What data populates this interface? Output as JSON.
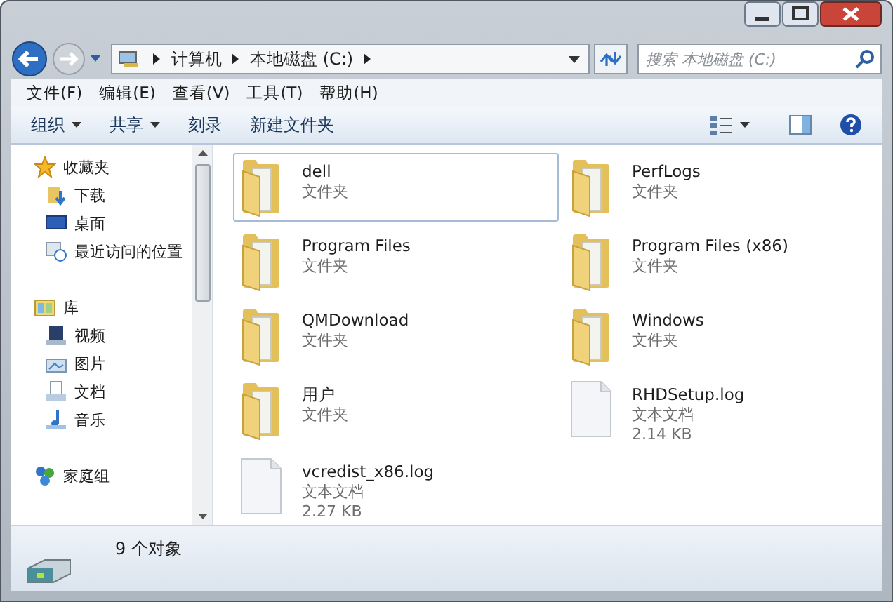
{
  "address": {
    "crumbs": [
      "计算机",
      "本地磁盘 (C:)"
    ]
  },
  "search": {
    "placeholder": "搜索 本地磁盘 (C:)"
  },
  "menu": [
    "文件(F)",
    "编辑(E)",
    "查看(V)",
    "工具(T)",
    "帮助(H)"
  ],
  "toolbar": [
    {
      "label": "组织",
      "dropdown": true
    },
    {
      "label": "共享",
      "dropdown": true
    },
    {
      "label": "刻录",
      "dropdown": false
    },
    {
      "label": "新建文件夹",
      "dropdown": false
    }
  ],
  "sidebar": {
    "groups": [
      {
        "label": "收藏夹",
        "kind": "favorites",
        "children": [
          {
            "label": "下载",
            "kind": "downloads"
          },
          {
            "label": "桌面",
            "kind": "desktop"
          },
          {
            "label": "最近访问的位置",
            "kind": "recent"
          }
        ]
      },
      {
        "label": "库",
        "kind": "libraries",
        "children": [
          {
            "label": "视频",
            "kind": "videos"
          },
          {
            "label": "图片",
            "kind": "pictures"
          },
          {
            "label": "文档",
            "kind": "documents"
          },
          {
            "label": "音乐",
            "kind": "music"
          }
        ]
      },
      {
        "label": "家庭组",
        "kind": "homegroup"
      }
    ]
  },
  "files": [
    {
      "name": "dell",
      "type": "文件夹",
      "kind": "folder",
      "selected": true
    },
    {
      "name": "PerfLogs",
      "type": "文件夹",
      "kind": "folder",
      "selected": false
    },
    {
      "name": "Program Files",
      "type": "文件夹",
      "kind": "folder",
      "selected": false
    },
    {
      "name": "Program Files (x86)",
      "type": "文件夹",
      "kind": "folder",
      "selected": false
    },
    {
      "name": "QMDownload",
      "type": "文件夹",
      "kind": "folder",
      "selected": false
    },
    {
      "name": "Windows",
      "type": "文件夹",
      "kind": "folder",
      "selected": false
    },
    {
      "name": "用户",
      "type": "文件夹",
      "kind": "folder",
      "selected": false
    },
    {
      "name": "RHDSetup.log",
      "type": "文本文档",
      "size": "2.14 KB",
      "kind": "document",
      "selected": false
    },
    {
      "name": "vcredist_x86.log",
      "type": "文本文档",
      "size": "2.27 KB",
      "kind": "document",
      "selected": false
    }
  ],
  "status_bar": {
    "count": "9 个对象"
  }
}
